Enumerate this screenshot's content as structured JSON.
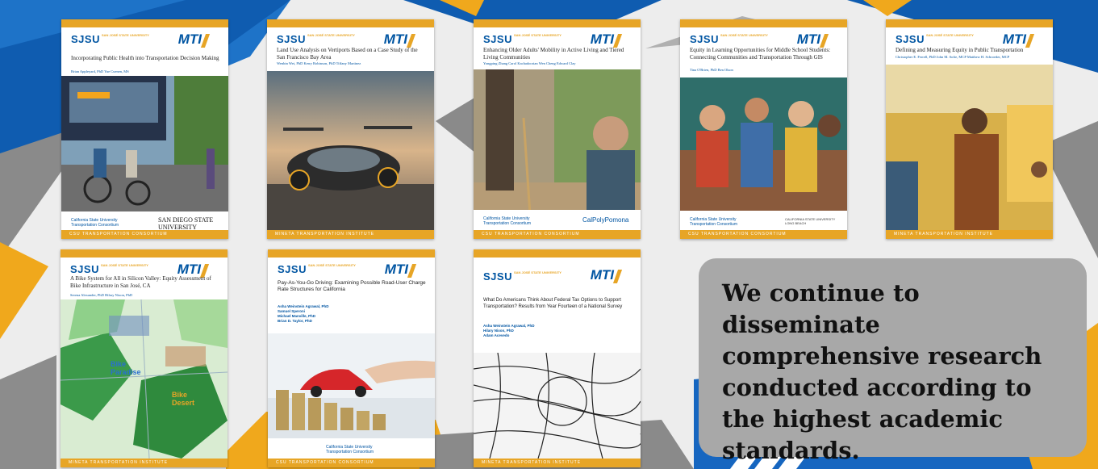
{
  "headline": "We continue to disseminate comprehensive research conducted according to the highest academic standards.",
  "brand": {
    "sjsu": "SJSU",
    "sjsu_sub": "SAN JOSÉ STATE UNIVERSITY",
    "mti": "MTI"
  },
  "colors": {
    "orange": "#e7a526",
    "blue": "#0055a2",
    "panel": "#a8a8a8"
  },
  "covers": [
    {
      "title": "Incorporating Public Health into Transportation Decision Making",
      "authors": "Brian Appleyard, PhD     Yue Cuenen, MS",
      "footer": "CSU TRANSPORTATION CONSORTIUM",
      "logo_left": "California State University Transportation Consortium",
      "logo_right": "SAN DIEGO STATE UNIVERSITY"
    },
    {
      "title": "Land Use Analysis on Vertiports Based on a Case Study of the San Francisco Bay Area",
      "authors": "Wenbin Wei, PhD   Kerry Robinson, PhD   Tiffany Martinez",
      "footer": "MINETA TRANSPORTATION INSTITUTE"
    },
    {
      "title": "Enhancing Older Adults' Mobility in Active Living and Tiered Living Communities",
      "authors": "Yongping Zhang   Carol Kachadoorian   Wen Cheng   Edward Clay",
      "footer": "CSU TRANSPORTATION CONSORTIUM",
      "logo_left": "California State University Transportation Consortium",
      "logo_right": "CalPolyPomona"
    },
    {
      "title": "Equity in Learning Opportunities for Middle School Students: Connecting Communities and Transportation Through GIS",
      "authors": "Tina O'Brien, PhD   Ben Olson",
      "footer": "CSU TRANSPORTATION CONSORTIUM",
      "logo_left": "California State University Transportation Consortium",
      "logo_right": "CALIFORNIA STATE UNIVERSITY LONG BEACH"
    },
    {
      "title": "Defining and Measuring Equity in Public Transportation",
      "authors": "Christopher E. Ferrell, PhD   John M. Sofie, MCP   Matthew H. Schroeder, MCP",
      "footer": "MINETA TRANSPORTATION INSTITUTE"
    },
    {
      "title": "A Bike System for All in Silicon Valley: Equity Assessment of Bike Infrastructure in San José, CA",
      "authors": "Serena Alexander, PhD   Hilary Nixon, PhD",
      "footer": "MINETA TRANSPORTATION INSTITUTE",
      "map_a": "Bike Paradise",
      "map_b": "Bike Desert"
    },
    {
      "title": "Pay-As-You-Go Driving: Examining Possible Road-User Charge Rate Structures for California",
      "authors": "Asha Weinstein Agrawal, PhD\nSamuel Speroni\nMichael Manville, PhD\nBrian D. Taylor, PhD",
      "footer": "CSU TRANSPORTATION CONSORTIUM",
      "logo_left": "California State University Transportation Consortium"
    },
    {
      "title": "What Do Americans Think About Federal Tax Options to Support Transportation? Results from Year Fourteen of a National Survey",
      "authors": "Asha Weinstein Agrawal, PhD\nHilary Nixon, PhD\nAdam Acevedo",
      "footer": "MINETA TRANSPORTATION INSTITUTE"
    }
  ]
}
